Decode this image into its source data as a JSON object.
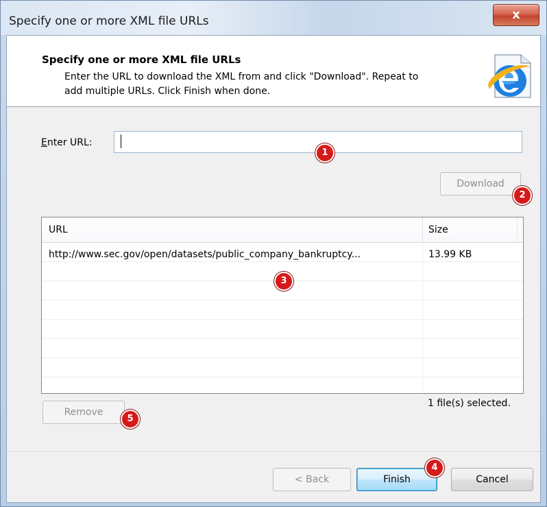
{
  "window": {
    "title": "Specify one or more XML file URLs",
    "close_label": "x"
  },
  "header": {
    "title": "Specify one or more XML file URLs",
    "description_line1": "Enter the URL to download the XML from and click \"Download\". Repeat to",
    "description_line2": "add multiple URLs. Click Finish when done.",
    "icon": "internet-explorer-icon"
  },
  "url_field": {
    "label_prefix": "E",
    "label_rest": "nter URL:",
    "value": ""
  },
  "download_button": {
    "label": "Download"
  },
  "list": {
    "columns": [
      "URL",
      "Size"
    ],
    "rows": [
      {
        "url": "http://www.sec.gov/open/datasets/public_company_bankruptcy...",
        "size": "13.99 KB"
      }
    ]
  },
  "remove_button": {
    "label": "Remove"
  },
  "status": "1 file(s) selected.",
  "footer": {
    "back_label": "< Back",
    "finish_label": "Finish",
    "cancel_label": "Cancel"
  },
  "markers": [
    "1",
    "2",
    "3",
    "4",
    "5"
  ],
  "colors": {
    "marker": "#d61a1a",
    "accent": "#3c7fb1"
  }
}
